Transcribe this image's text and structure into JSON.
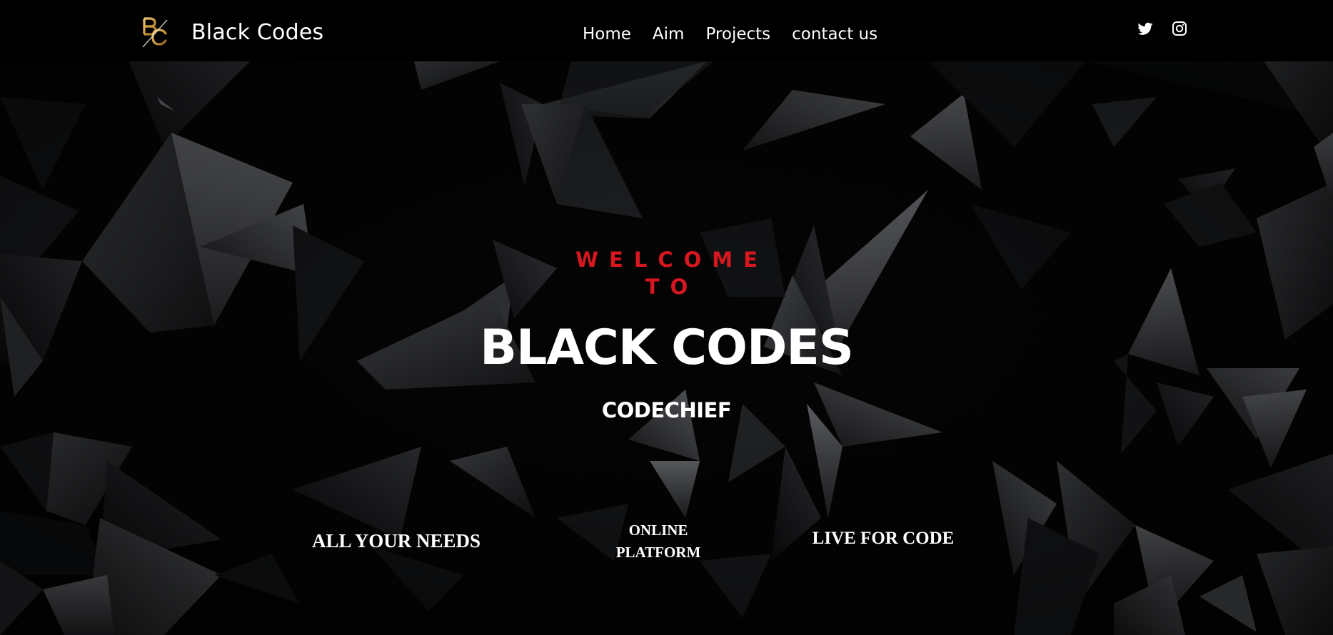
{
  "header": {
    "logo": {
      "letters": "BC",
      "colors": [
        "#d4a24c",
        "#b3892f"
      ]
    },
    "brand_name": "Black Codes",
    "nav": [
      {
        "label": "Home"
      },
      {
        "label": "Aim"
      },
      {
        "label": "Projects"
      },
      {
        "label": "contact us"
      }
    ],
    "social": [
      {
        "icon": "twitter-icon"
      },
      {
        "icon": "instagram-icon"
      }
    ]
  },
  "hero": {
    "welcome_line1": "WELCOME",
    "welcome_line2": "TO",
    "title": "BLACK CODES",
    "subtitle": "CODECHIEF",
    "features": [
      {
        "text": "ALL YOUR NEEDS"
      },
      {
        "line1": "ONLINE",
        "line2": "PLATFORM"
      },
      {
        "text": "LIVE FOR CODE"
      }
    ],
    "background": "dark low-poly triangles"
  },
  "colors": {
    "header_bg": "#000000",
    "accent_red": "#d6171f",
    "text": "#ffffff",
    "logo_gold": "#d4a24c"
  }
}
